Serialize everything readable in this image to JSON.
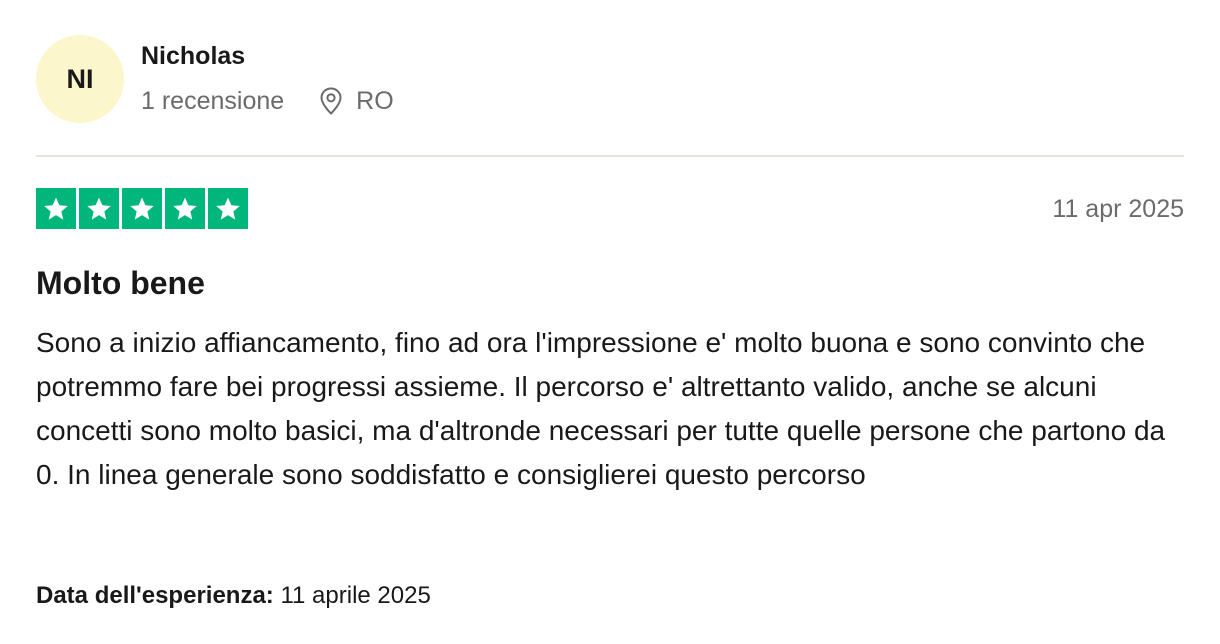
{
  "reviewer": {
    "initials": "NI",
    "name": "Nicholas",
    "review_count": "1 recensione",
    "location_icon": "map-pin-icon",
    "country": "RO",
    "avatar_color": "#fcf6cc"
  },
  "review": {
    "rating": 5,
    "rating_max": 5,
    "star_color": "#00b67a",
    "date": "11 apr 2025",
    "title": "Molto bene",
    "body": "Sono a inizio affiancamento, fino ad ora l'impressione e' molto buona e sono convinto che potremmo fare bei progressi assieme. Il percorso e' altrettanto valido, anche se alcuni concetti sono molto basici, ma d'altronde necessari per tutte quelle persone che partono da 0. In linea generale sono soddisfatto e consiglierei questo percorso",
    "experience_label": "Data dell'esperienza:",
    "experience_date": "11 aprile 2025"
  }
}
